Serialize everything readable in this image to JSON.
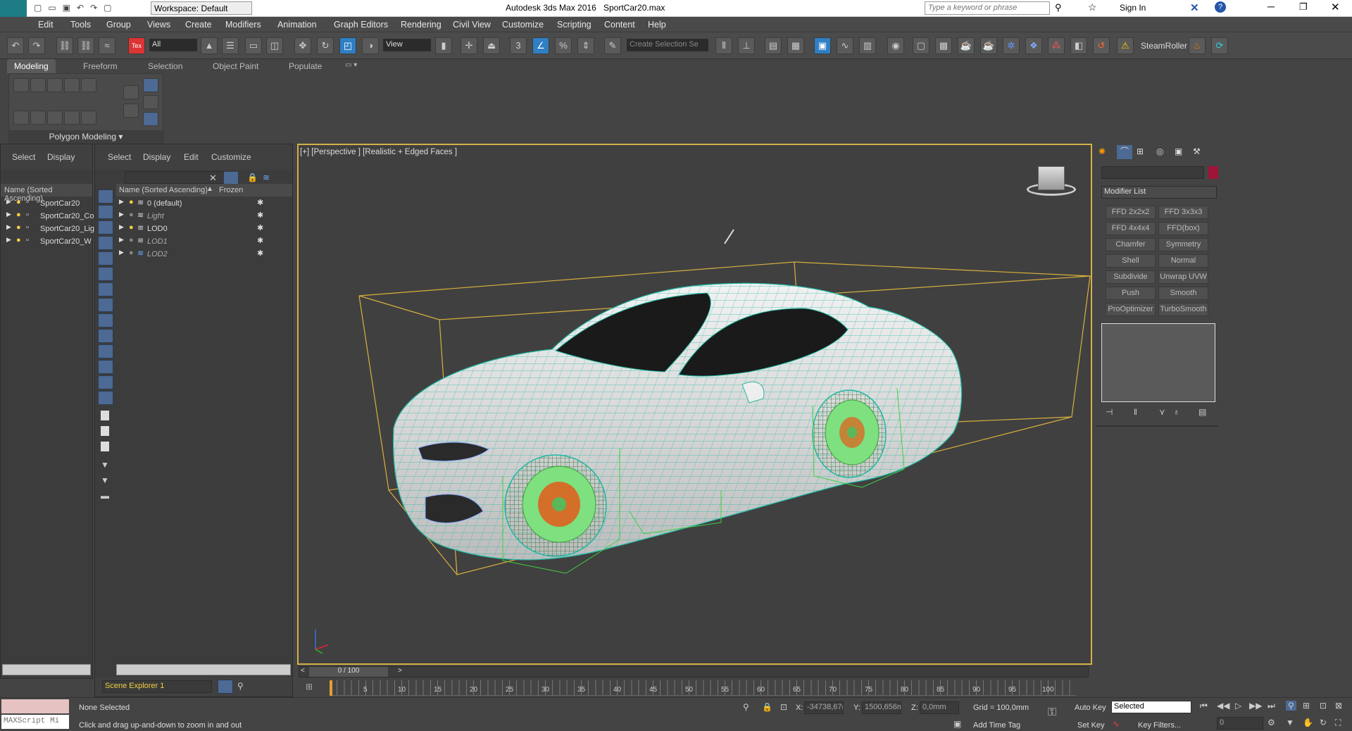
{
  "titlebar": {
    "workspace": "Workspace: Default",
    "title": "Autodesk 3ds Max 2016",
    "file": "SportCar20.max",
    "search_placeholder": "Type a keyword or phrase",
    "sign_in": "Sign In",
    "logo": "MAX"
  },
  "menu": [
    "Edit",
    "Tools",
    "Group",
    "Views",
    "Create",
    "Modifiers",
    "Animation",
    "Graph Editors",
    "Rendering",
    "Civil View",
    "Customize",
    "Scripting",
    "Content",
    "Help"
  ],
  "toolbar": {
    "selection_filter": "All",
    "ref_coord": "View",
    "named_selection": "Create Selection Se",
    "snap_value": "3",
    "steamroller": "SteamRoller"
  },
  "ribbon": {
    "tabs": [
      "Modeling",
      "Freeform",
      "Selection",
      "Object Paint",
      "Populate"
    ],
    "panel_label": "Polygon Modeling"
  },
  "left_explorer": {
    "menu": [
      "Select",
      "Display"
    ],
    "column": "Name (Sorted Ascending)",
    "items": [
      "SportCar20",
      "SportCar20_Co",
      "SportCar20_Lig",
      "SportCar20_W"
    ]
  },
  "layer_explorer": {
    "menu": [
      "Select",
      "Display",
      "Edit",
      "Customize"
    ],
    "columns": [
      "Name (Sorted Ascending)",
      "Frozen"
    ],
    "items": [
      "0 (default)",
      "Light",
      "LOD0",
      "LOD1",
      "LOD2"
    ],
    "footer": "Scene Explorer 1"
  },
  "viewport": {
    "label": "[+] [Perspective ] [Realistic + Edged Faces ]"
  },
  "command_panel": {
    "modifier_list": "Modifier List",
    "modifiers": [
      "FFD 2x2x2",
      "FFD 3x3x3",
      "FFD 4x4x4",
      "FFD(box)",
      "Chamfer",
      "Symmetry",
      "Shell",
      "Normal",
      "Subdivide",
      "Unwrap UVW",
      "Push",
      "Smooth",
      "ProOptimizer",
      "TurboSmooth"
    ],
    "color_swatch": "#a0143a"
  },
  "timeline": {
    "frame_display": "0 / 100",
    "ticks": [
      "0",
      "5",
      "10",
      "15",
      "20",
      "25",
      "30",
      "35",
      "40",
      "45",
      "50",
      "55",
      "60",
      "65",
      "70",
      "75",
      "80",
      "85",
      "90",
      "95",
      "100"
    ]
  },
  "status": {
    "maxscript": "MAXScript Mi",
    "selection": "None Selected",
    "prompt": "Click and drag up-and-down to zoom in and out",
    "x_label": "X:",
    "x": "-34738,67(",
    "y_label": "Y:",
    "y": "1500,656m",
    "z_label": "Z:",
    "z": "0,0mm",
    "grid": "Grid = 100,0mm",
    "add_time_tag": "Add Time Tag",
    "auto_key": "Auto Key",
    "set_key": "Set Key",
    "key_mode": "Selected",
    "key_filters": "Key Filters...",
    "frame": "0"
  }
}
